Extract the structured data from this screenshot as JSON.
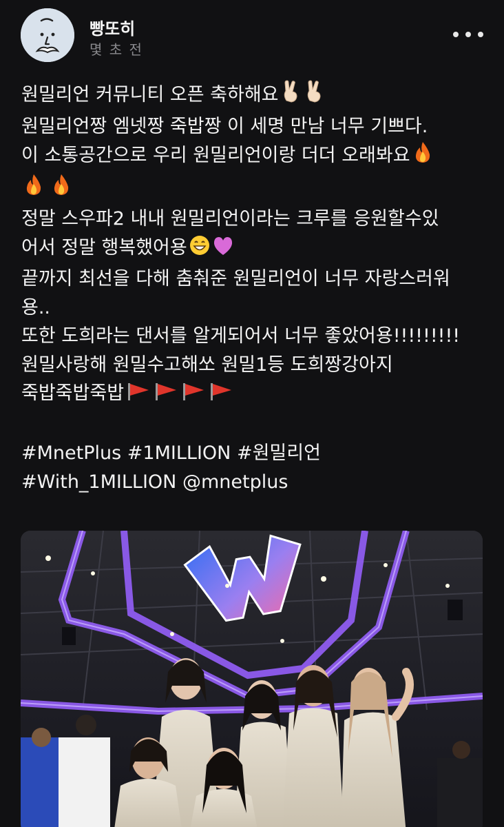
{
  "post": {
    "author": {
      "name": "빵또히",
      "avatar_icon": "mustache-face-avatar-icon"
    },
    "timestamp": "몇 초 전",
    "more_icon": "more-horizontal-icon",
    "lines": [
      "원밀리언 커뮤니티 오픈 축하해요",
      "원밀리언짱 엠넷짱 죽밥짱 이 세명 만남 너무 기쁘다.",
      "이 소통공간으로 우리 원밀리언이랑 더더 오래봐요",
      "정말 스우파2 내내 원밀리언이라는 크루를 응원할수있",
      "어서 정말 행복했어용",
      "끝까지 최선을 다해 춤춰준 원밀리언이 너무 자랑스러워",
      "용..",
      "또한 도희라는 댄서를 알게되어서 너무 좋았어용!!!!!!!!!",
      "원밀사랑해 원밀수고해쏘 원밀1등 도희짱강아지",
      "죽밥죽밥죽밥"
    ],
    "hashtags": {
      "line1": [
        "#MnetPlus",
        "#1MILLION",
        "#원밀리언"
      ],
      "line2": [
        "#With_1MILLION"
      ],
      "mention": "@mnetplus"
    },
    "emoji_icons": [
      "victory-hand-icon",
      "fire-icon",
      "grinning-face-icon",
      "purple-heart-icon",
      "red-flag-icon"
    ],
    "photo": {
      "stage_logo_letter": "W",
      "description_icon": "stage-group-photo"
    }
  },
  "colors": {
    "background": "#111113",
    "text": "#f3f3f3",
    "muted": "#8a8a8e",
    "stage_purple": "#8f5cf0",
    "logo_blue": "#3a6ff2",
    "logo_pink": "#f06aa8",
    "flag_red": "#e0352b"
  }
}
